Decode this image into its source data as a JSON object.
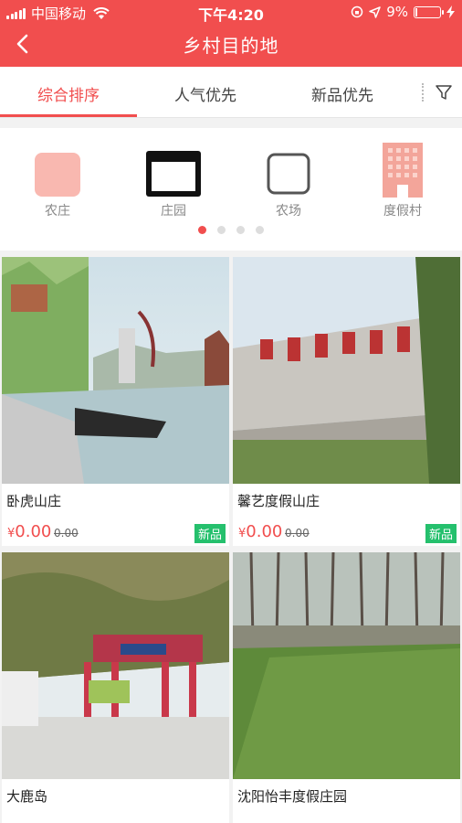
{
  "status": {
    "carrier": "中国移动",
    "time": "下午4:20",
    "battery": "9%",
    "battery_level": 0.09
  },
  "nav": {
    "title": "乡村目的地"
  },
  "tabs": [
    {
      "label": "综合排序",
      "active": true
    },
    {
      "label": "人气优先",
      "active": false
    },
    {
      "label": "新品优先",
      "active": false
    }
  ],
  "categories": [
    {
      "label": "农庄",
      "icon": "farmhouse-icon"
    },
    {
      "label": "庄园",
      "icon": "manor-icon"
    },
    {
      "label": "农场",
      "icon": "farm-icon"
    },
    {
      "label": "度假村",
      "icon": "resort-icon"
    }
  ],
  "pager": {
    "pages": 4,
    "current": 1
  },
  "listings": [
    {
      "name": "卧虎山庄",
      "currency": "¥",
      "price": "0.00",
      "original": "0.00",
      "badge": "新品"
    },
    {
      "name": "馨艺度假山庄",
      "currency": "¥",
      "price": "0.00",
      "original": "0.00",
      "badge": "新品"
    },
    {
      "name": "大鹿岛"
    },
    {
      "name": "沈阳怡丰度假庄园"
    }
  ],
  "colors": {
    "accent": "#f14e4e",
    "badge": "#25c06d"
  }
}
